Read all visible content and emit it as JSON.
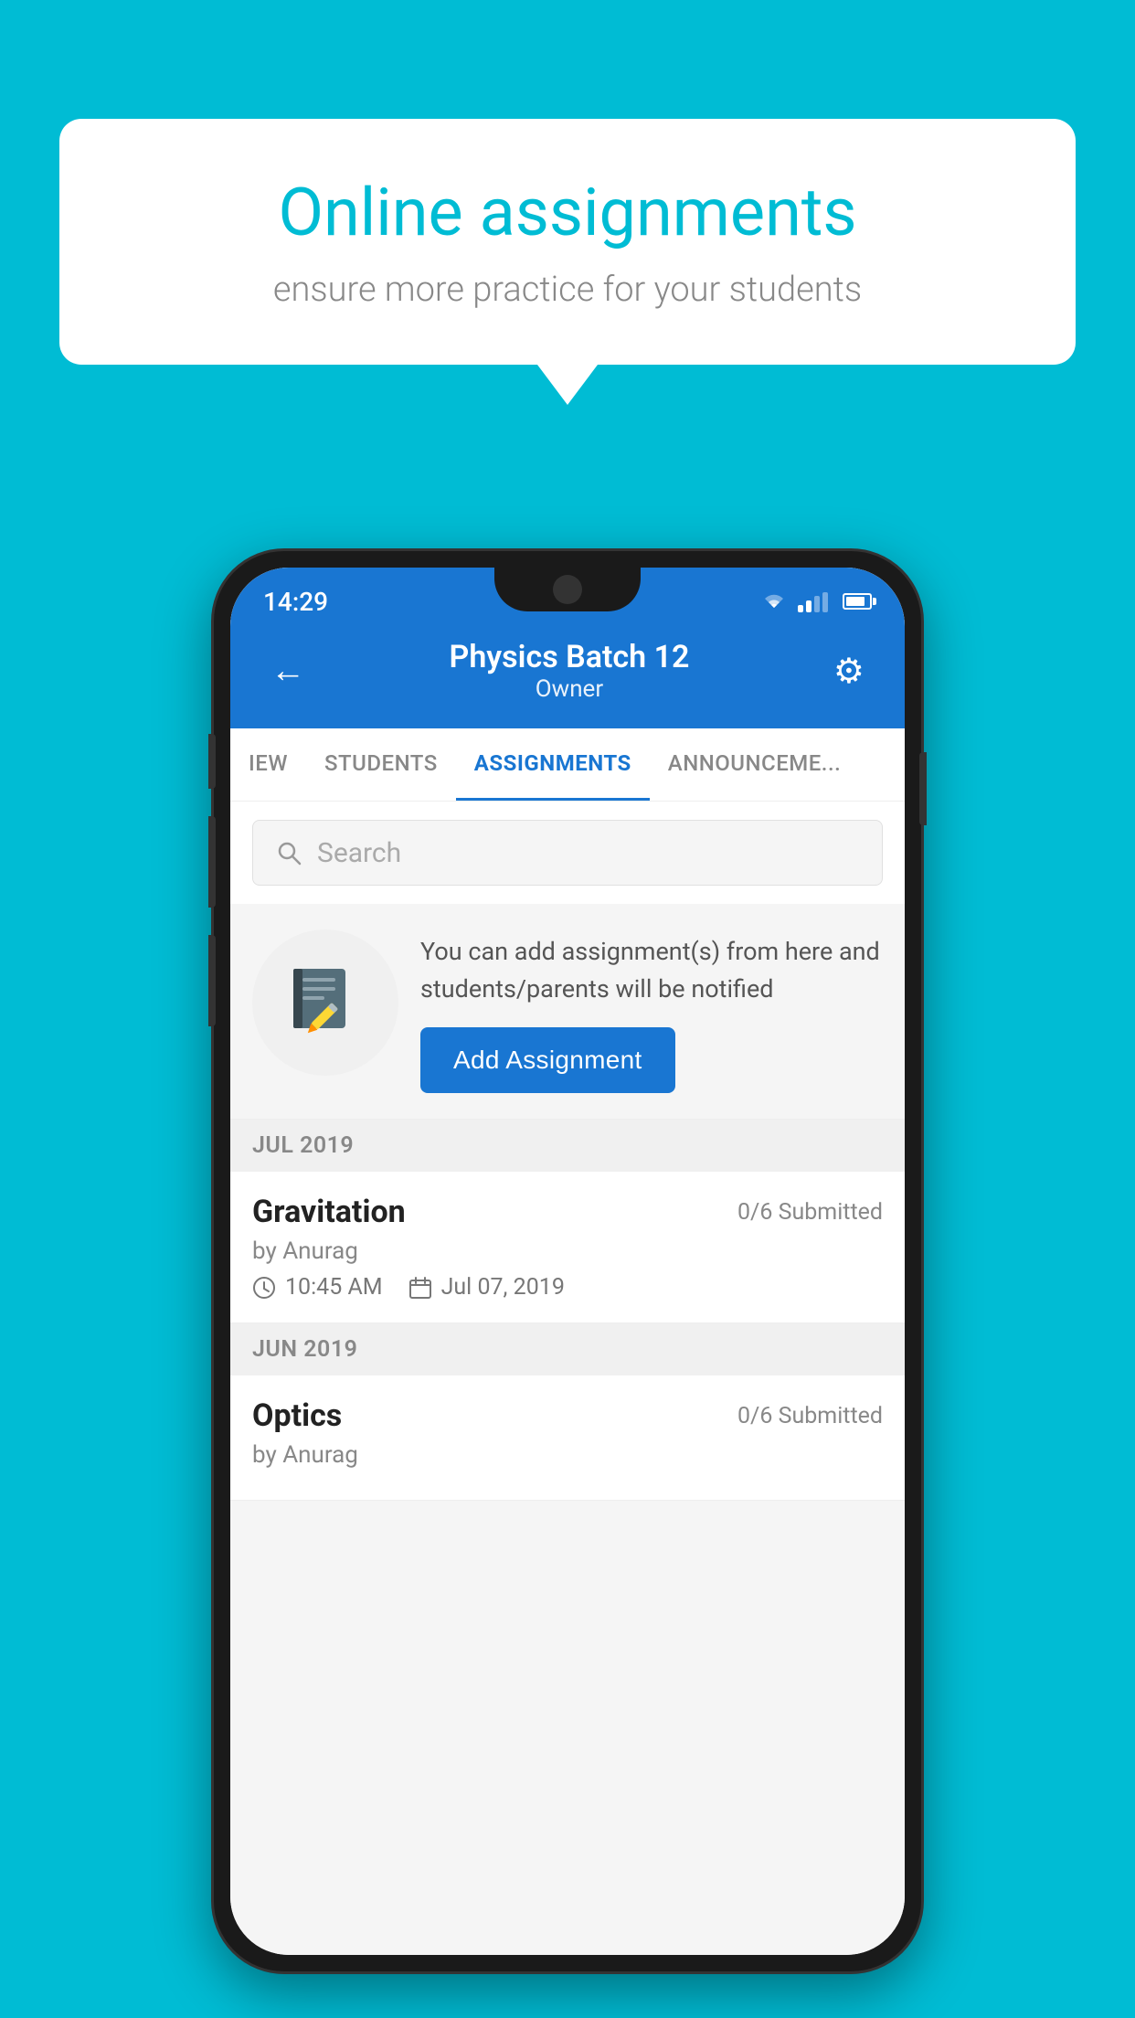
{
  "background_color": "#00BCD4",
  "speech_bubble": {
    "title": "Online assignments",
    "subtitle": "ensure more practice for your students"
  },
  "phone": {
    "status_bar": {
      "time": "14:29"
    },
    "header": {
      "title": "Physics Batch 12",
      "subtitle": "Owner",
      "back_label": "←",
      "settings_label": "⚙"
    },
    "tabs": [
      {
        "label": "IEW",
        "active": false
      },
      {
        "label": "STUDENTS",
        "active": false
      },
      {
        "label": "ASSIGNMENTS",
        "active": true
      },
      {
        "label": "ANNOUNCEMENTS",
        "active": false
      }
    ],
    "search": {
      "placeholder": "Search"
    },
    "promo": {
      "description": "You can add assignment(s) from here and students/parents will be notified",
      "button_label": "Add Assignment"
    },
    "month_sections": [
      {
        "month": "JUL 2019",
        "assignments": [
          {
            "name": "Gravitation",
            "submitted": "0/6 Submitted",
            "by": "by Anurag",
            "time": "10:45 AM",
            "date": "Jul 07, 2019"
          }
        ]
      },
      {
        "month": "JUN 2019",
        "assignments": [
          {
            "name": "Optics",
            "submitted": "0/6 Submitted",
            "by": "by Anurag",
            "time": "",
            "date": ""
          }
        ]
      }
    ]
  }
}
